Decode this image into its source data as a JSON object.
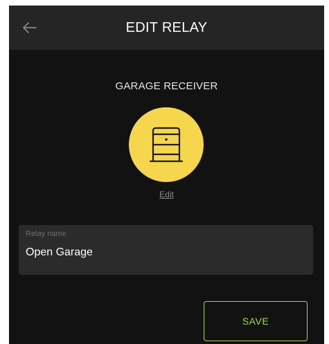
{
  "header": {
    "title": "EDIT RELAY",
    "back_icon": "arrow-left-icon"
  },
  "device": {
    "name": "GARAGE RECEIVER",
    "icon": "garage-door-icon",
    "icon_bg_color": "#f5d64d",
    "edit_label": "Edit"
  },
  "relay_name_field": {
    "label": "Relay name",
    "value": "Open Garage"
  },
  "actions": {
    "save_label": "SAVE",
    "accent_color": "#a6d84a"
  }
}
